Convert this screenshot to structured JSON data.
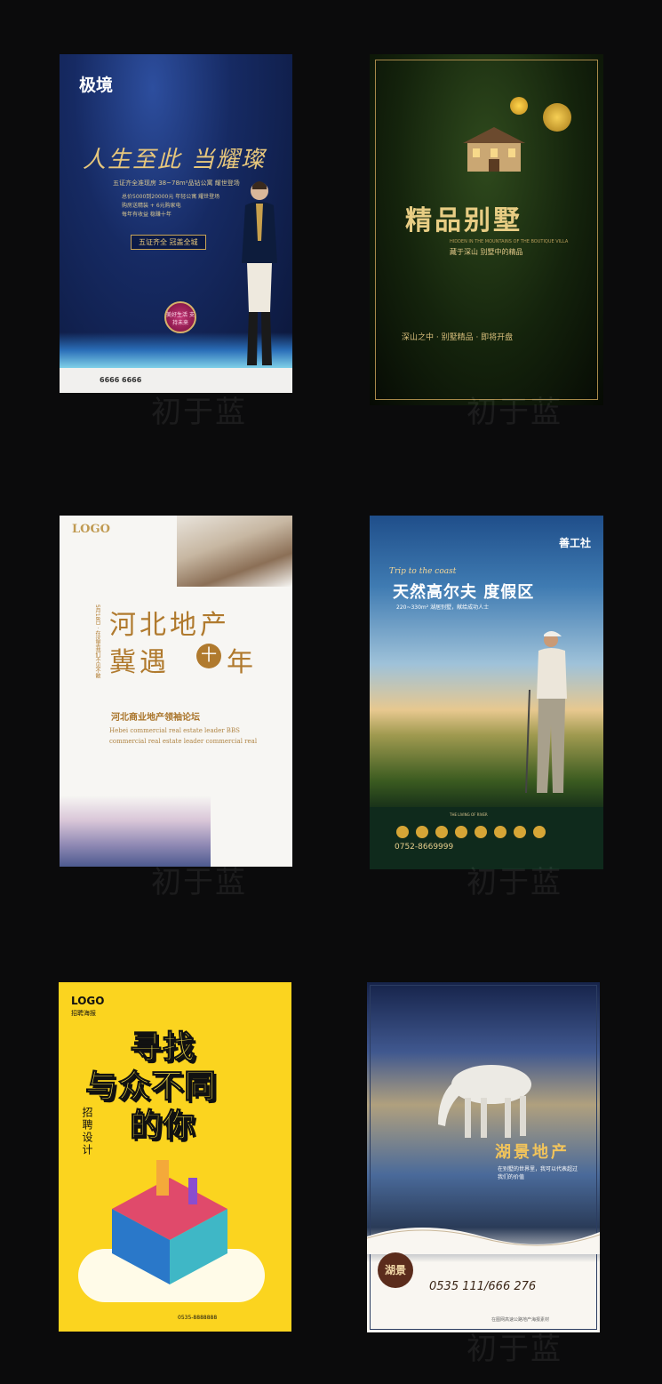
{
  "watermark": "初于蓝",
  "posters": [
    {
      "logo": "极境",
      "title": "人生至此 当耀璨",
      "sub": "五证齐全准现房 38~78m²品钻公寓 耀世登场",
      "lines": [
        "总价5000到20000元 年轻公寓 耀世登场",
        "购房送精装 + 6元购家电",
        "每年有收益 稳赚十年"
      ],
      "badge": "五证齐全  冠盖全城",
      "seal": "美好生活 支持未来",
      "phone": "6666 6666"
    },
    {
      "title": "精品别墅",
      "en": "HIDDEN IN THE MOUNTAINS OF THE BOUTIQUE VILLA",
      "sub": "藏于深山 别墅中的精品",
      "slogan": "深山之中 · 别墅精品 · 即将开盘"
    },
    {
      "logo": "LOGO",
      "title1": "河北地产",
      "title2a": "冀遇",
      "ten": "十",
      "title2b": "年",
      "date": "5月18日 · 在这里我们不见不散",
      "forum": "河北商业地产领袖论坛",
      "en1": "Hebei commercial real estate leader BBS",
      "en2": "commercial real estate leader  commercial real"
    },
    {
      "logo": "善工社",
      "script": "Trip to the coast",
      "title": "天然高尔夫  度假区",
      "sub": "220~330m² 湖居别墅，献给成功人士",
      "river": "THE LIVING OF RIVER",
      "phone": "0752-8669999"
    },
    {
      "logo": "LOGO",
      "logo_sub": "招聘海报",
      "h1": "寻找",
      "h2": "与众不同",
      "h3": "的你",
      "vertical": "招聘设计",
      "phone": "0535-8888888"
    },
    {
      "title": "湖景地产",
      "sub1": "在别墅的世界里，我可以代表超过",
      "sub2": "我们的价值",
      "seal": "湖景",
      "phone": "0535 111/666 276",
      "addr": "在图网高速公路地产海报素材"
    }
  ],
  "colors": {
    "background": "#0b0b0c",
    "gold": "#e7c77c",
    "yellow": "#fbd41f"
  }
}
